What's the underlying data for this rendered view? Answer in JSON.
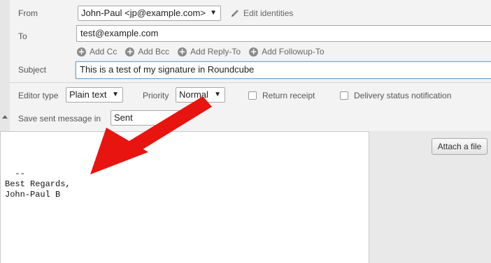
{
  "header": {
    "from_label": "From",
    "from_value": "John-Paul <jp@example.com>",
    "edit_identities_label": "Edit identities",
    "to_label": "To",
    "to_value": "test@example.com",
    "add_links": [
      "Add Cc",
      "Add Bcc",
      "Add Reply-To",
      "Add Followup-To"
    ],
    "subject_label": "Subject",
    "subject_value": "This is a test of my signature in Roundcube"
  },
  "options": {
    "editor_type_label": "Editor type",
    "editor_type_value": "Plain text",
    "priority_label": "Priority",
    "priority_value": "Normal",
    "return_receipt_label": "Return receipt",
    "delivery_status_label": "Delivery status notification",
    "save_sent_label": "Save sent message in",
    "save_sent_value": "Sent"
  },
  "body": {
    "text": "--\nBest Regards,\nJohn-Paul B"
  },
  "attachments": {
    "attach_button_label": "Attach a file"
  },
  "colors": {
    "annotation_arrow": "#e8140f",
    "focus_border": "#71a5cf"
  }
}
